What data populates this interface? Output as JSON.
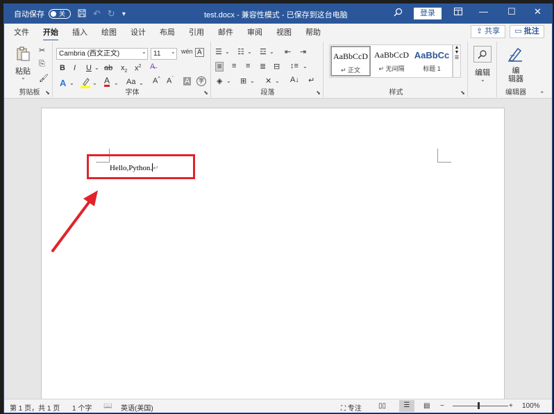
{
  "titlebar": {
    "autosave_label": "自动保存",
    "autosave_state": "关",
    "document_title": "test.docx - 兼容性模式 - 已保存到这台电脑",
    "login_label": "登录",
    "icons": [
      "save-icon",
      "undo-icon",
      "redo-icon",
      "customize-icon",
      "search-icon",
      "ribbon-display-icon",
      "minimize-icon",
      "maximize-icon",
      "close-icon"
    ],
    "accent": "#2b579a"
  },
  "tabs": {
    "items": [
      "文件",
      "开始",
      "插入",
      "绘图",
      "设计",
      "布局",
      "引用",
      "邮件",
      "审阅",
      "视图",
      "帮助"
    ],
    "active": "开始",
    "share_label": "共享",
    "comment_label": "批注"
  },
  "ribbon": {
    "clipboard": {
      "paste_label": "粘贴",
      "group_label": "剪贴板"
    },
    "font": {
      "font_name": "Cambria (西文正文)",
      "font_size": "11",
      "group_label": "字体",
      "bold": "B",
      "italic": "I",
      "underline": "U",
      "strike": "ab",
      "font_color_glyph": "A",
      "case_label": "Aa"
    },
    "paragraph": {
      "group_label": "段落"
    },
    "styles": {
      "group_label": "样式",
      "items": [
        {
          "sample": "AaBbCcD",
          "name": "正文"
        },
        {
          "sample": "AaBbCcD",
          "name": "无间隔"
        },
        {
          "sample": "AaBbCc",
          "name": "标题 1"
        }
      ]
    },
    "editing": {
      "label": "编辑"
    },
    "editor": {
      "label": "编\n辑器",
      "group_label": "编辑器"
    }
  },
  "document": {
    "text": "Hello,Python.",
    "para_mark": "↵",
    "highlight_color": "#e0242a"
  },
  "statusbar": {
    "page_info": "第 1 页，共 1 页",
    "word_count": "1 个字",
    "language": "英语(美国)",
    "focus_label": "专注",
    "zoom_label": "100%",
    "zoom_percent": 100
  }
}
